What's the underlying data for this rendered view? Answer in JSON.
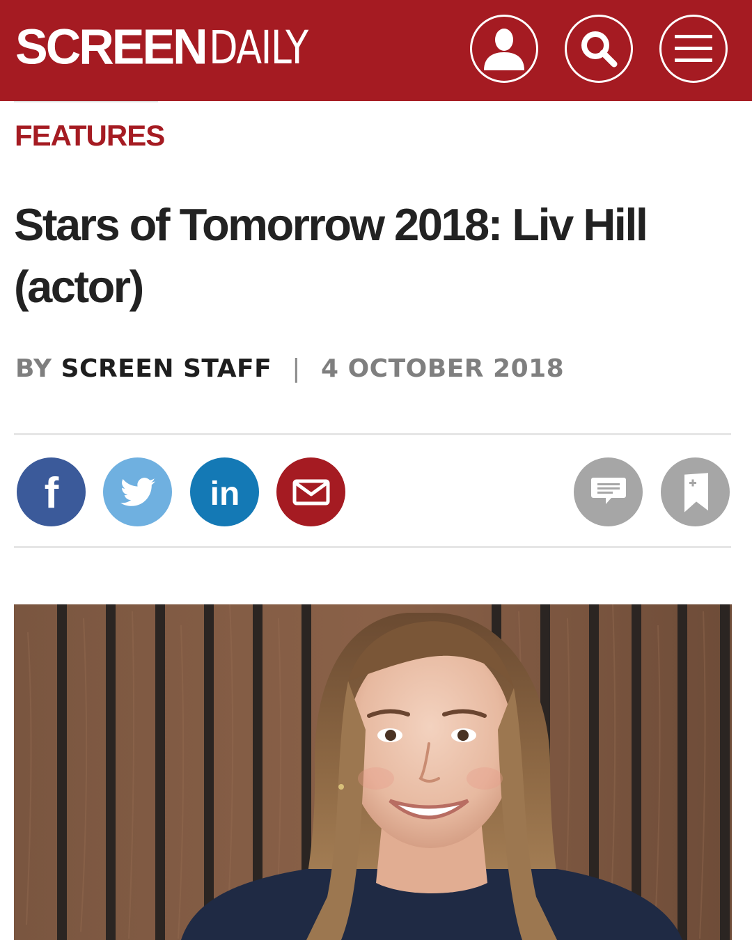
{
  "header": {
    "logo_bold": "SCREEN",
    "logo_light": "DAILY",
    "brand_color": "#a51b22",
    "buttons": [
      "user-icon",
      "search-icon",
      "menu-icon"
    ]
  },
  "article": {
    "section": "FEATURES",
    "title": "Stars of Tomorrow 2018: Liv Hill (actor)",
    "byline_prefix": "BY",
    "author": "SCREEN STAFF",
    "separator": "|",
    "date": "4 OCTOBER 2018"
  },
  "share": {
    "items": [
      {
        "icon": "facebook-icon",
        "color": "#3b5a9a"
      },
      {
        "icon": "twitter-icon",
        "color": "#6fb0e0"
      },
      {
        "icon": "linkedin-icon",
        "color": "#1479b5"
      },
      {
        "icon": "email-icon",
        "color": "#a51b22"
      }
    ],
    "tools": [
      {
        "icon": "comment-icon",
        "color": "#a6a6a6"
      },
      {
        "icon": "bookmark-icon",
        "color": "#a6a6a6"
      }
    ],
    "linkedin_text": "in",
    "facebook_text": "f"
  },
  "hero_image": {
    "subject": "portrait-photo"
  }
}
